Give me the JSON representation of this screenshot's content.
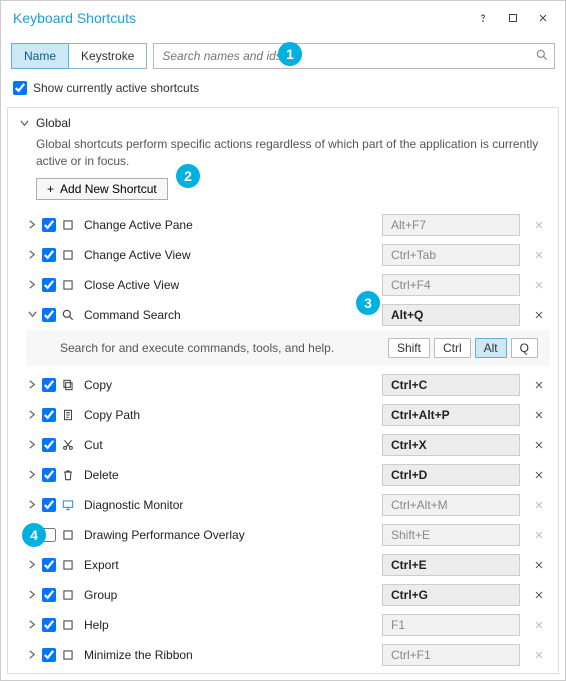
{
  "window": {
    "title": "Keyboard Shortcuts"
  },
  "tabs": {
    "name": "Name",
    "keystroke": "Keystroke"
  },
  "search": {
    "placeholder": "Search names and ids"
  },
  "show_active": {
    "label": "Show currently active shortcuts",
    "checked": true
  },
  "badges": {
    "b1": "1",
    "b2": "2",
    "b3": "3",
    "b4": "4"
  },
  "section": {
    "title": "Global",
    "description": "Global shortcuts perform specific actions regardless of which part of the application is currently active or in focus.",
    "add_label": "Add New Shortcut"
  },
  "detail": {
    "text": "Search for and execute commands, tools, and help.",
    "keys": [
      "Shift",
      "Ctrl",
      "Alt",
      "Q"
    ],
    "selected": "Alt"
  },
  "rows": [
    {
      "label": "Change Active Pane",
      "hotkey": "Alt+F7",
      "strong": false,
      "checked": true,
      "expanded": false,
      "icon": "box",
      "clear_on": false
    },
    {
      "label": "Change Active View",
      "hotkey": "Ctrl+Tab",
      "strong": false,
      "checked": true,
      "expanded": false,
      "icon": "box",
      "clear_on": false
    },
    {
      "label": "Close Active View",
      "hotkey": "Ctrl+F4",
      "strong": false,
      "checked": true,
      "expanded": false,
      "icon": "box",
      "clear_on": false
    },
    {
      "label": "Command Search",
      "hotkey": "Alt+Q",
      "strong": true,
      "checked": true,
      "expanded": true,
      "icon": "search",
      "clear_on": true
    },
    {
      "label": "Copy",
      "hotkey": "Ctrl+C",
      "strong": true,
      "checked": true,
      "expanded": false,
      "icon": "copy",
      "clear_on": true
    },
    {
      "label": "Copy Path",
      "hotkey": "Ctrl+Alt+P",
      "strong": true,
      "checked": true,
      "expanded": false,
      "icon": "doc",
      "clear_on": true
    },
    {
      "label": "Cut",
      "hotkey": "Ctrl+X",
      "strong": true,
      "checked": true,
      "expanded": false,
      "icon": "cut",
      "clear_on": true
    },
    {
      "label": "Delete",
      "hotkey": "Ctrl+D",
      "strong": true,
      "checked": true,
      "expanded": false,
      "icon": "trash",
      "clear_on": true
    },
    {
      "label": "Diagnostic Monitor",
      "hotkey": "Ctrl+Alt+M",
      "strong": false,
      "checked": true,
      "expanded": false,
      "icon": "monitor",
      "clear_on": false
    },
    {
      "label": "Drawing Performance Overlay",
      "hotkey": "Shift+E",
      "strong": false,
      "checked": false,
      "expanded": false,
      "icon": "box",
      "clear_on": false
    },
    {
      "label": "Export",
      "hotkey": "Ctrl+E",
      "strong": true,
      "checked": true,
      "expanded": false,
      "icon": "box",
      "clear_on": true
    },
    {
      "label": "Group",
      "hotkey": "Ctrl+G",
      "strong": true,
      "checked": true,
      "expanded": false,
      "icon": "box",
      "clear_on": true
    },
    {
      "label": "Help",
      "hotkey": "F1",
      "strong": false,
      "checked": true,
      "expanded": false,
      "icon": "box",
      "clear_on": false
    },
    {
      "label": "Minimize the Ribbon",
      "hotkey": "Ctrl+F1",
      "strong": false,
      "checked": true,
      "expanded": false,
      "icon": "box",
      "clear_on": false
    }
  ]
}
